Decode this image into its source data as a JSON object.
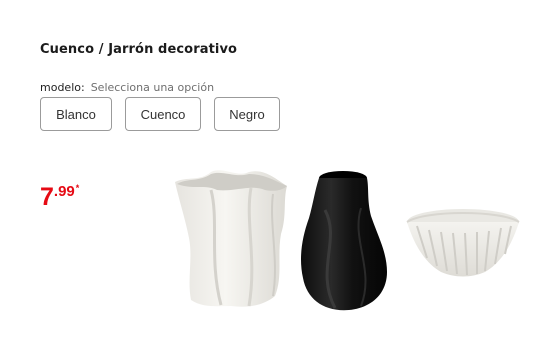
{
  "product": {
    "title": "Cuenco / Jarrón decorativo"
  },
  "variant": {
    "label": "modelo:",
    "selected_text": "Selecciona una opción",
    "options": [
      "Blanco",
      "Cuenco",
      "Negro"
    ]
  },
  "price": {
    "integer": "7",
    "decimal": ".99",
    "marker": "*",
    "color": "#e60a14"
  },
  "image": {
    "items": [
      "white-vase",
      "black-vase",
      "white-bowl"
    ]
  }
}
